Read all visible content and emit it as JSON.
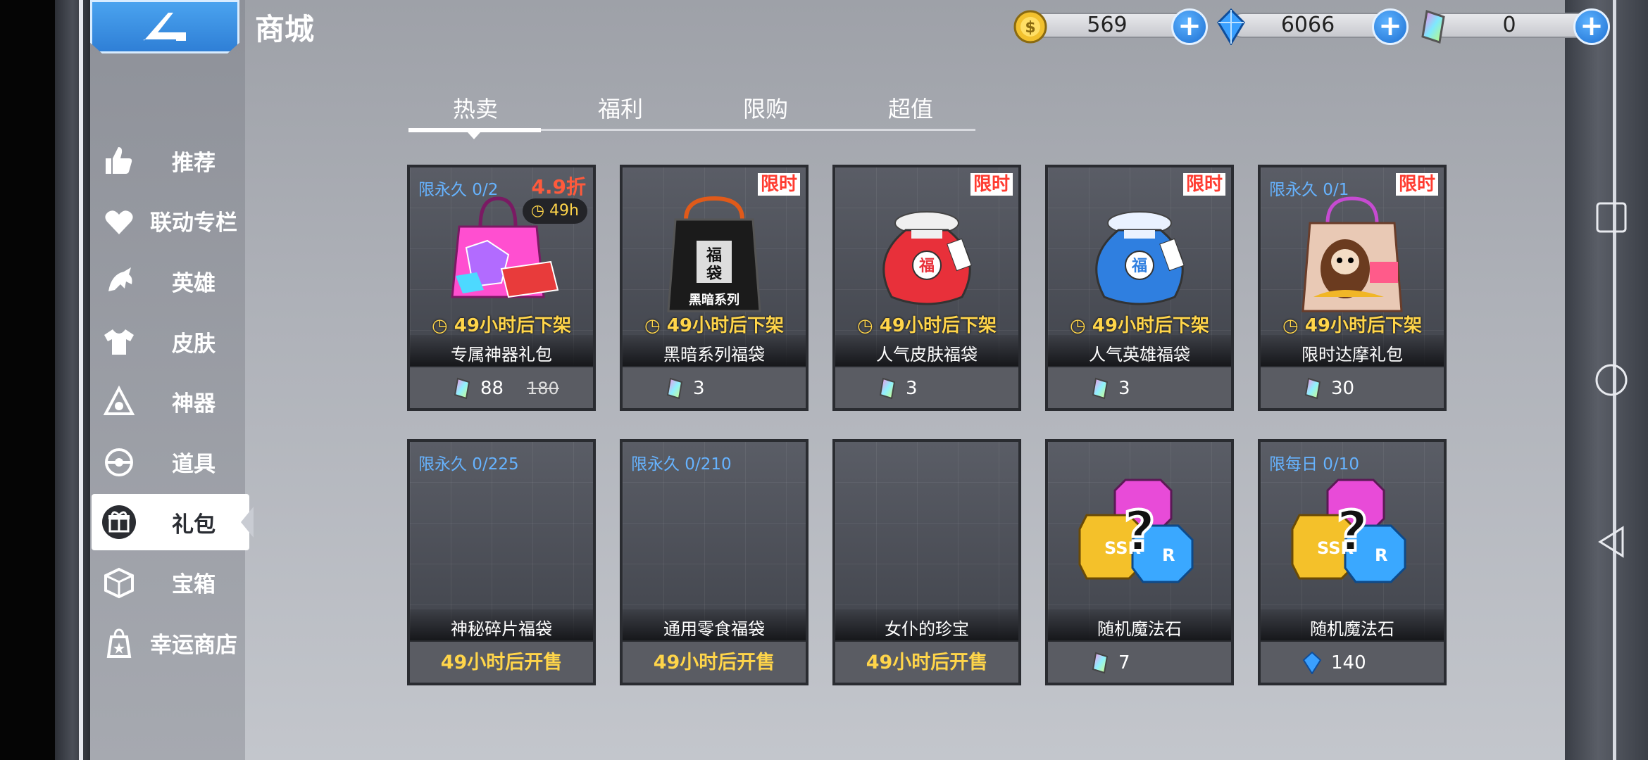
{
  "header": {
    "title": "商城",
    "currencies": [
      {
        "name": "gold-coin",
        "value": "569",
        "color": "#f2c12e"
      },
      {
        "name": "blue-crystal",
        "value": "6066",
        "color": "#3aa0ff"
      },
      {
        "name": "rainbow-crystal",
        "value": "0",
        "color": "#b58cff"
      }
    ]
  },
  "sidebar": {
    "items": [
      {
        "label": "推荐",
        "icon": "thumbs-up-icon"
      },
      {
        "label": "联动专栏",
        "icon": "heart-icon"
      },
      {
        "label": "英雄",
        "icon": "hero-icon"
      },
      {
        "label": "皮肤",
        "icon": "shirt-icon"
      },
      {
        "label": "神器",
        "icon": "artifact-icon"
      },
      {
        "label": "道具",
        "icon": "item-icon"
      },
      {
        "label": "礼包",
        "icon": "gift-icon",
        "active": true
      },
      {
        "label": "宝箱",
        "icon": "box-icon"
      },
      {
        "label": "幸运商店",
        "icon": "lucky-bag-icon"
      }
    ]
  },
  "tabs": [
    {
      "label": "热卖",
      "active": true
    },
    {
      "label": "福利"
    },
    {
      "label": "限购"
    },
    {
      "label": "超值"
    }
  ],
  "cards": [
    {
      "limit": "限永久 0/2",
      "discount": "4.9折",
      "timer_chip": "49h",
      "countdown": "49小时后下架",
      "name": "专属神器礼包",
      "price": "88",
      "old_price": "180",
      "currency": "rainbow-crystal",
      "art": "pink-gift-bag"
    },
    {
      "badge": "限时",
      "countdown": "49小时后下架",
      "name": "黑暗系列福袋",
      "price": "3",
      "currency": "rainbow-crystal",
      "art": "black-lucky-bag",
      "bag_text": "福袋",
      "bag_sub": "黑暗系列"
    },
    {
      "badge": "限时",
      "countdown": "49小时后下架",
      "name": "人气皮肤福袋",
      "price": "3",
      "currency": "rainbow-crystal",
      "art": "red-lucky-pouch",
      "pouch_text": "福"
    },
    {
      "badge": "限时",
      "countdown": "49小时后下架",
      "name": "人气英雄福袋",
      "price": "3",
      "currency": "rainbow-crystal",
      "art": "blue-lucky-pouch",
      "pouch_text": "福"
    },
    {
      "limit": "限永久 0/1",
      "badge": "限时",
      "countdown": "49小时后下架",
      "name": "限时达摩礼包",
      "price": "30",
      "currency": "rainbow-crystal",
      "art": "daruma-gift-bag"
    },
    {
      "limit": "限永久 0/225",
      "name": "神秘碎片福袋",
      "sale": "49小时后开售",
      "art": "empty"
    },
    {
      "limit": "限永久 0/210",
      "name": "通用零食福袋",
      "sale": "49小时后开售",
      "art": "empty"
    },
    {
      "name": "女仆的珍宝",
      "sale": "49小时后开售",
      "art": "empty"
    },
    {
      "name": "随机魔法石",
      "price": "7",
      "currency": "rainbow-crystal",
      "art": "magic-stones"
    },
    {
      "limit": "限每日 0/10",
      "name": "随机魔法石",
      "price": "140",
      "currency": "blue-crystal",
      "art": "magic-stones"
    }
  ],
  "android_nav": [
    "recent-apps-icon",
    "home-icon",
    "back-icon"
  ]
}
